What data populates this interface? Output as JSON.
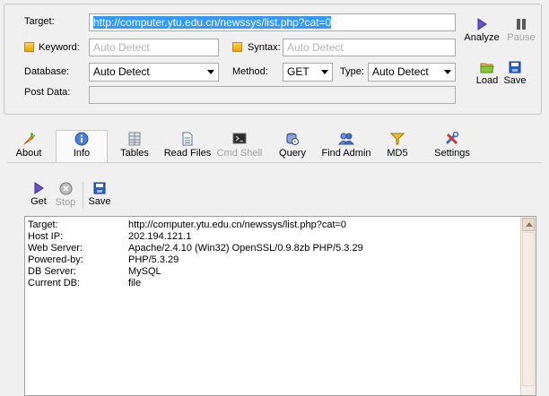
{
  "form": {
    "target_label": "Target:",
    "target_value": "http://computer.ytu.edu.cn/newssys/list.php?cat=0",
    "keyword_label": "Keyword:",
    "keyword_placeholder": "Auto Detect",
    "syntax_label": "Syntax:",
    "syntax_placeholder": "Auto Detect",
    "database_label": "Database:",
    "database_value": "Auto Detect",
    "method_label": "Method:",
    "method_value": "GET",
    "type_label": "Type:",
    "type_value": "Auto Detect",
    "postdata_label": "Post Data:",
    "postdata_value": ""
  },
  "side_buttons": {
    "analyze": "Analyze",
    "pause": "Pause",
    "load": "Load",
    "save": "Save"
  },
  "tabs": [
    {
      "label": "About",
      "icon": "carrot-icon"
    },
    {
      "label": "Info",
      "icon": "info-icon"
    },
    {
      "label": "Tables",
      "icon": "table-icon"
    },
    {
      "label": "Read Files",
      "icon": "document-icon"
    },
    {
      "label": "Cmd Shell",
      "icon": "terminal-icon"
    },
    {
      "label": "Query",
      "icon": "query-icon"
    },
    {
      "label": "Find Admin",
      "icon": "users-icon"
    },
    {
      "label": "MD5",
      "icon": "funnel-icon"
    },
    {
      "label": "Settings",
      "icon": "tools-icon"
    }
  ],
  "info_toolbar": {
    "get": "Get",
    "stop": "Stop",
    "save": "Save"
  },
  "info_rows": [
    {
      "key": "Target:",
      "value": "http://computer.ytu.edu.cn/newssys/list.php?cat=0"
    },
    {
      "key": "Host IP:",
      "value": "202.194.121.1"
    },
    {
      "key": "Web Server:",
      "value": "Apache/2.4.10 (Win32) OpenSSL/0.9.8zb PHP/5.3.29"
    },
    {
      "key": "Powered-by:",
      "value": "PHP/5.3.29"
    },
    {
      "key": "DB Server:",
      "value": "MySQL"
    },
    {
      "key": "Current DB:",
      "value": "file"
    }
  ],
  "colors": {
    "selection": "#3399ff",
    "checkbox": "#f0b400",
    "accent_purple": "#5a3fc0",
    "save_blue": "#2a5fc9"
  }
}
